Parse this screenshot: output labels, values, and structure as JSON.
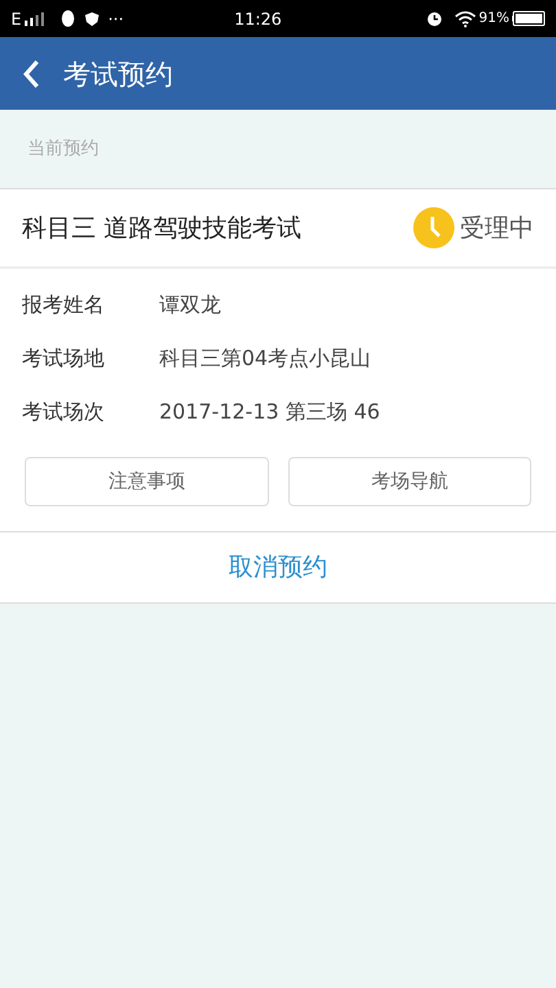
{
  "status_bar": {
    "network": "E",
    "more": "···",
    "time": "11:26",
    "battery_text": "91%"
  },
  "header": {
    "title": "考试预约"
  },
  "section_label": "当前预约",
  "card": {
    "title": "科目三 道路驾驶技能考试",
    "status": "受理中",
    "fields": [
      {
        "label": "报考姓名",
        "value": "谭双龙"
      },
      {
        "label": "考试场地",
        "value": "科目三第04考点小昆山"
      },
      {
        "label": "考试场次",
        "value": "2017-12-13 第三场 46"
      }
    ],
    "buttons": [
      "注意事项",
      "考场导航"
    ],
    "cancel": "取消预约"
  }
}
